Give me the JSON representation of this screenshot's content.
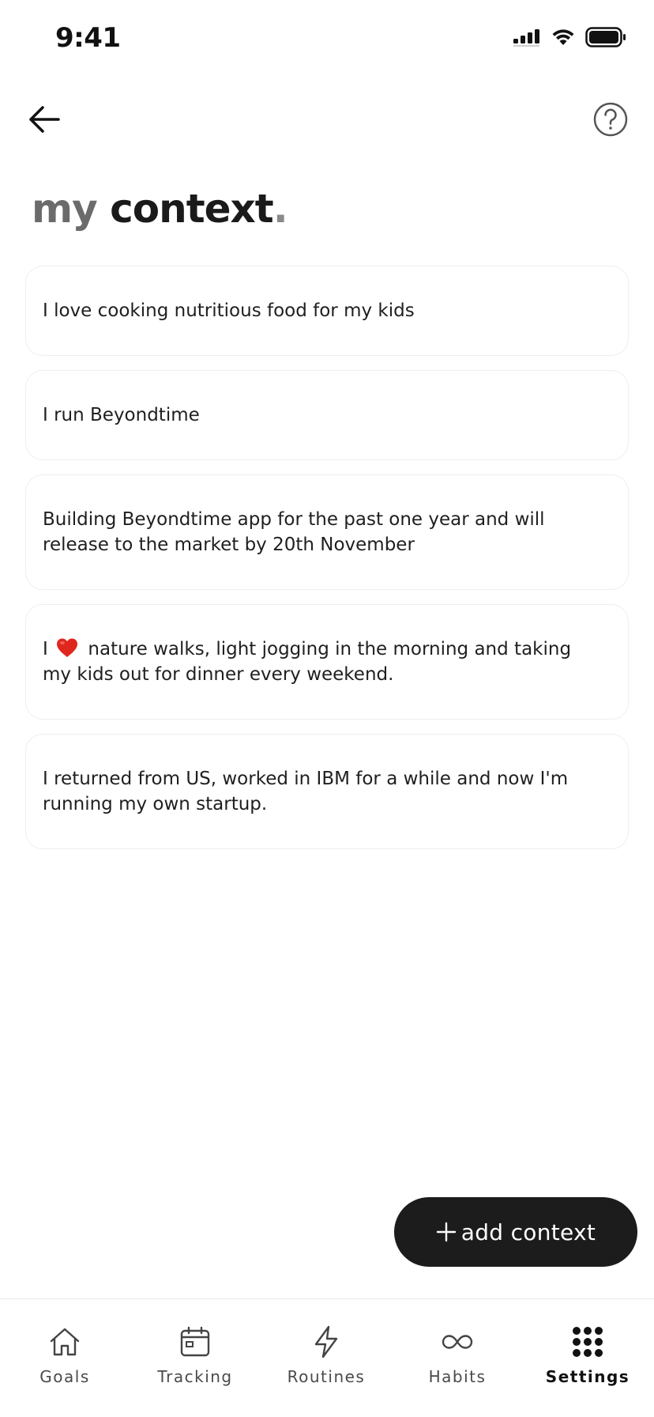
{
  "status_bar": {
    "time": "9:41"
  },
  "header": {
    "back_icon": "arrow-left-icon",
    "help_icon": "question-circle-icon"
  },
  "title": {
    "prefix": "my",
    "main": "context",
    "dot": "."
  },
  "contexts": [
    {
      "text": "I love cooking nutritious food for my kids"
    },
    {
      "text": "I run Beyondtime"
    },
    {
      "text": "Building Beyondtime app for the past one year and will release to the market by 20th November"
    },
    {
      "before": "I",
      "emoji": "heart-icon",
      "after": "nature walks, light jogging in the morning and taking my kids out for dinner every weekend."
    },
    {
      "text": "I returned from US, worked in IBM for a while and now I'm running my own startup."
    }
  ],
  "add_button": {
    "label": "add context",
    "icon": "plus-icon"
  },
  "tabs": [
    {
      "label": "Goals",
      "icon": "home-icon",
      "active": false
    },
    {
      "label": "Tracking",
      "icon": "calendar-icon",
      "active": false
    },
    {
      "label": "Routines",
      "icon": "lightning-icon",
      "active": false
    },
    {
      "label": "Habits",
      "icon": "infinity-icon",
      "active": false
    },
    {
      "label": "Settings",
      "icon": "grid-dots-icon",
      "active": true
    }
  ],
  "colors": {
    "button_bg": "#1c1c1c",
    "card_border": "#f0eded",
    "heart": "#e0271e",
    "title_muted": "#6b6b6b"
  }
}
